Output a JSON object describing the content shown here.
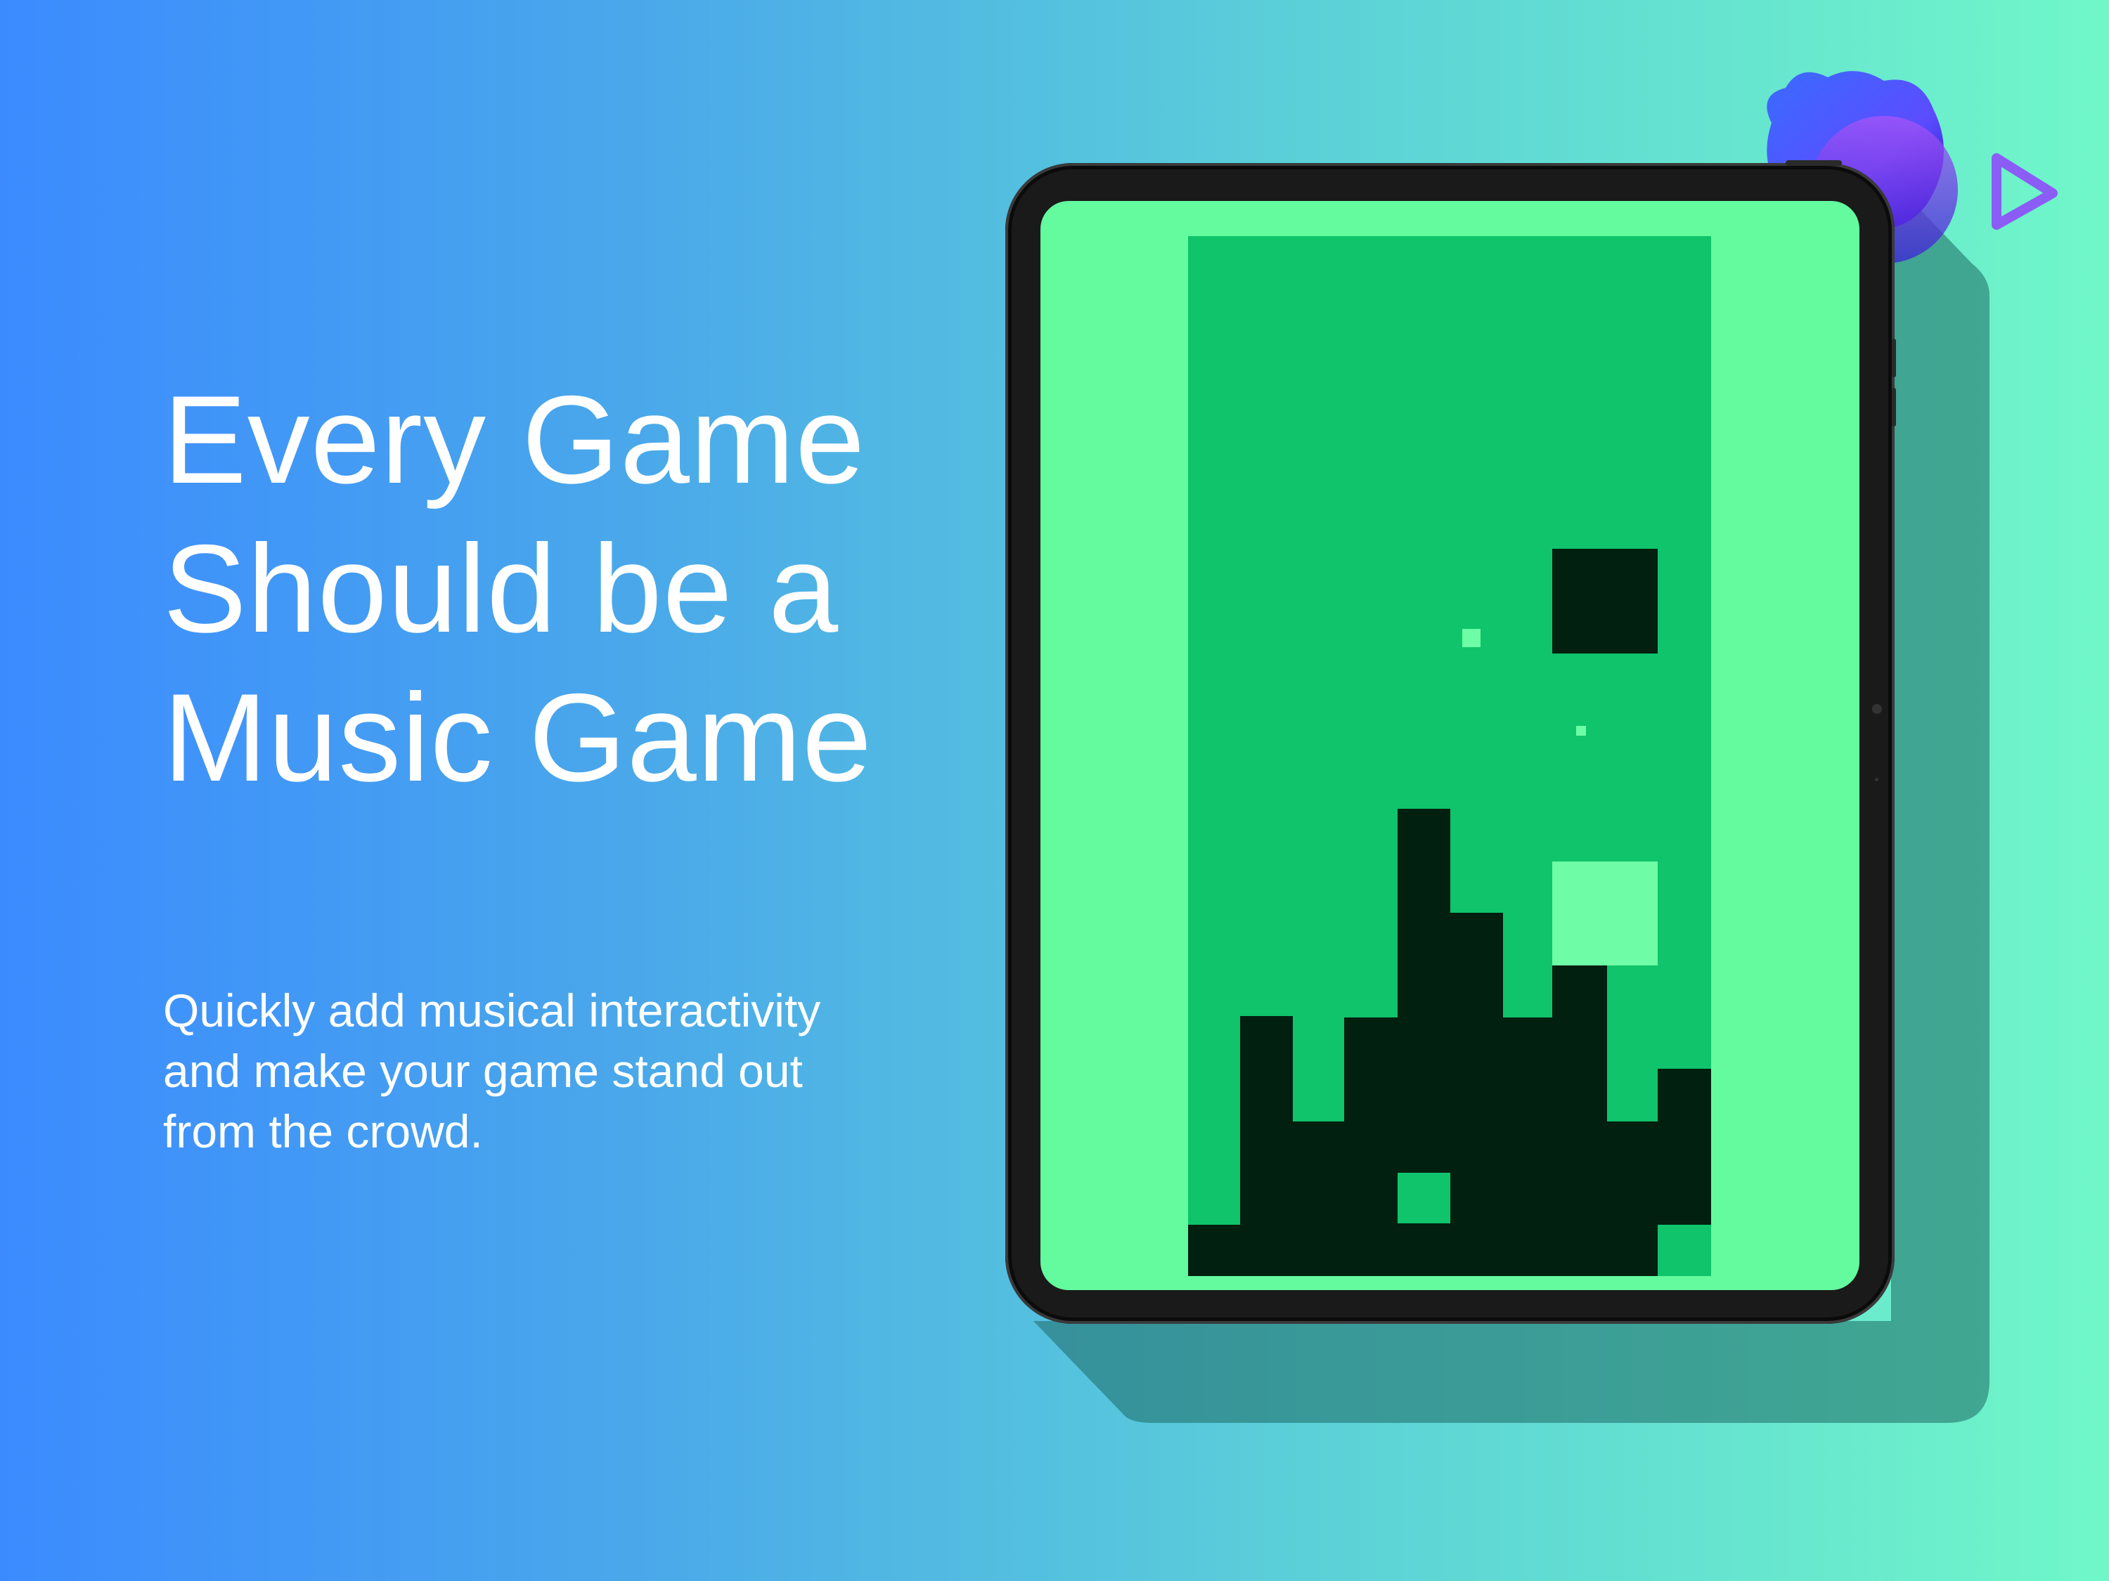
{
  "headline": {
    "line1": "Every Game",
    "line2": "Should be a",
    "line3": "Music Game"
  },
  "subtitle": {
    "line1": "Quickly add musical interactivity",
    "line2": "and make your game stand out",
    "line3": "from the crowd."
  },
  "logo": {
    "icon": "play-triangle-icon",
    "blob_color": "#5b4dff",
    "accent_color": "#8b5cf6"
  },
  "colors": {
    "background_start": "#3b8bff",
    "background_end": "#70f7c8",
    "screen_background": "#64fa9e",
    "playfield": "#0fc46b",
    "block_dark": "#01200f",
    "block_light": "#6ffca6"
  },
  "game": {
    "type": "falling-block music game",
    "grid_columns": 10,
    "grid_rows": 20
  }
}
